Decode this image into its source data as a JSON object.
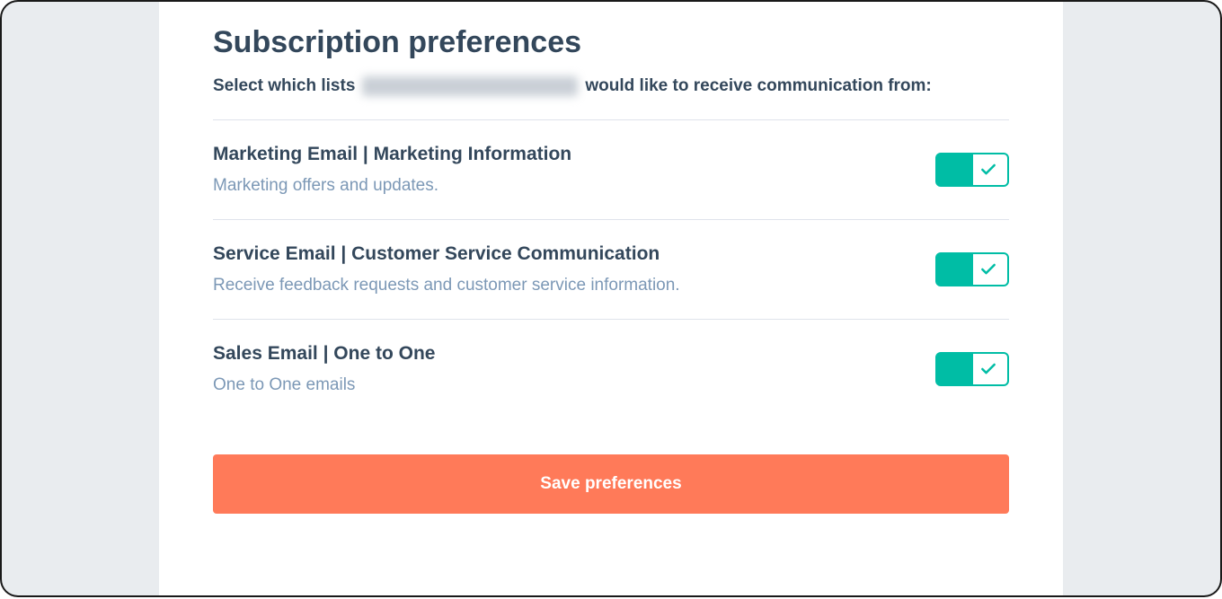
{
  "page": {
    "title": "Subscription preferences",
    "subtitle_prefix": "Select which lists",
    "subtitle_suffix": "would like to receive communication from:"
  },
  "preferences": [
    {
      "title": "Marketing Email | Marketing Information",
      "description": "Marketing offers and updates.",
      "enabled": true
    },
    {
      "title": "Service Email | Customer Service Communication",
      "description": "Receive feedback requests and customer service information.",
      "enabled": true
    },
    {
      "title": "Sales Email | One to One",
      "description": "One to One emails",
      "enabled": true
    }
  ],
  "actions": {
    "save_label": "Save preferences"
  }
}
